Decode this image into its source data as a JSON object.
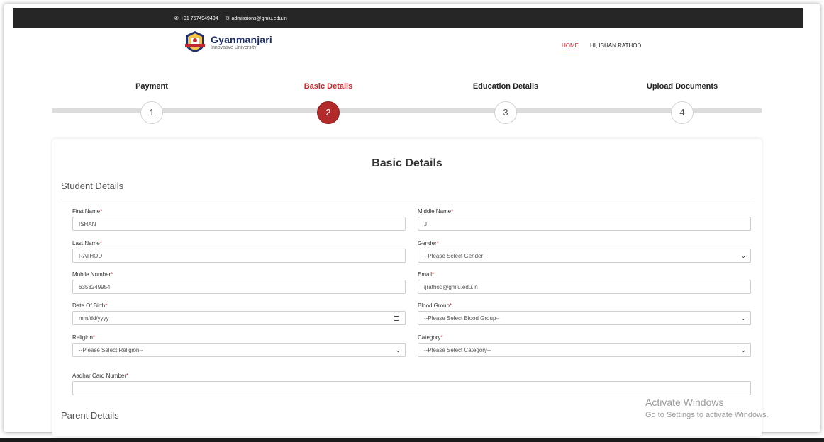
{
  "topbar": {
    "phone": "+91 7574949494",
    "email": "admissions@gmiu.edu.in"
  },
  "logo": {
    "name": "Gyanmanjari",
    "subtitle": "Innovative University"
  },
  "nav": {
    "home": "HOME",
    "user": "HI, ISHAN RATHOD"
  },
  "stepper": {
    "steps": [
      {
        "label": "Payment",
        "number": "1"
      },
      {
        "label": "Basic Details",
        "number": "2"
      },
      {
        "label": "Education Details",
        "number": "3"
      },
      {
        "label": "Upload Documents",
        "number": "4"
      }
    ],
    "active_index": 1
  },
  "card": {
    "title": "Basic Details",
    "section_student": "Student Details",
    "section_parent": "Parent Details"
  },
  "form": {
    "first_name": {
      "label": "First Name",
      "value": "ISHAN"
    },
    "middle_name": {
      "label": "Middle Name",
      "value": "J"
    },
    "last_name": {
      "label": "Last Name",
      "value": "RATHOD"
    },
    "gender": {
      "label": "Gender",
      "value": "--Please Select Gender--"
    },
    "mobile": {
      "label": "Mobile Number",
      "value": "6353249954"
    },
    "email": {
      "label": "Email",
      "value": "ijrathod@gmiu.edu.in"
    },
    "dob": {
      "label": "Date Of Birth",
      "value": "mm/dd/yyyy"
    },
    "blood_group": {
      "label": "Blood Group",
      "value": "--Please Select Blood Group--"
    },
    "religion": {
      "label": "Religion",
      "value": "--Please Select Religion--"
    },
    "category": {
      "label": "Category",
      "value": "--Please Select Category--"
    },
    "aadhar": {
      "label": "Aadhar Card Number",
      "value": ""
    },
    "required_mark": "*"
  },
  "watermark": {
    "title": "Activate Windows",
    "subtitle": "Go to Settings to activate Windows."
  },
  "colors": {
    "accent": "#c1272d",
    "topbar": "#262626",
    "active_step": "#b32a2a"
  }
}
